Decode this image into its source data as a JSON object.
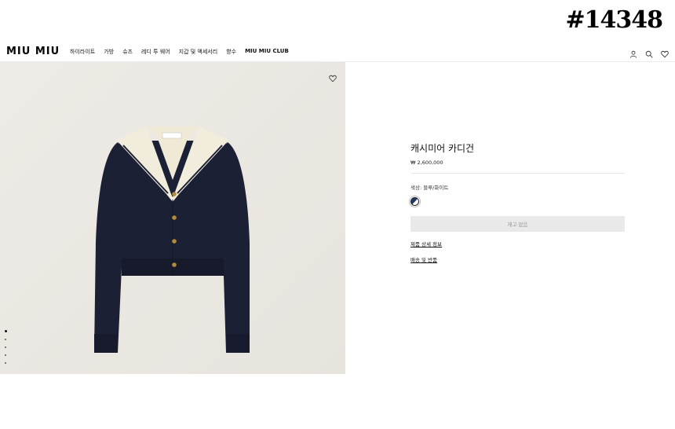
{
  "tag": "#14348",
  "nav": {
    "logo": "MIU MIU",
    "items": [
      "하이라이트",
      "가방",
      "슈즈",
      "레디 투 웨어",
      "지갑 및 액세서리",
      "향수",
      "MIU MIU CLUB"
    ]
  },
  "product": {
    "title": "캐시미어 카디건",
    "price": "₩ 2,600,000",
    "color_label": "색상: 블루/화이트",
    "button_label": "재고 없음",
    "links": [
      "제품 상세 정보",
      "배송 및 반품"
    ]
  },
  "gallery": {
    "count": 5,
    "active": 0
  },
  "colors": {
    "navy": "#1b2034",
    "cream": "#f1ecdc",
    "background": "#e9e5df"
  }
}
